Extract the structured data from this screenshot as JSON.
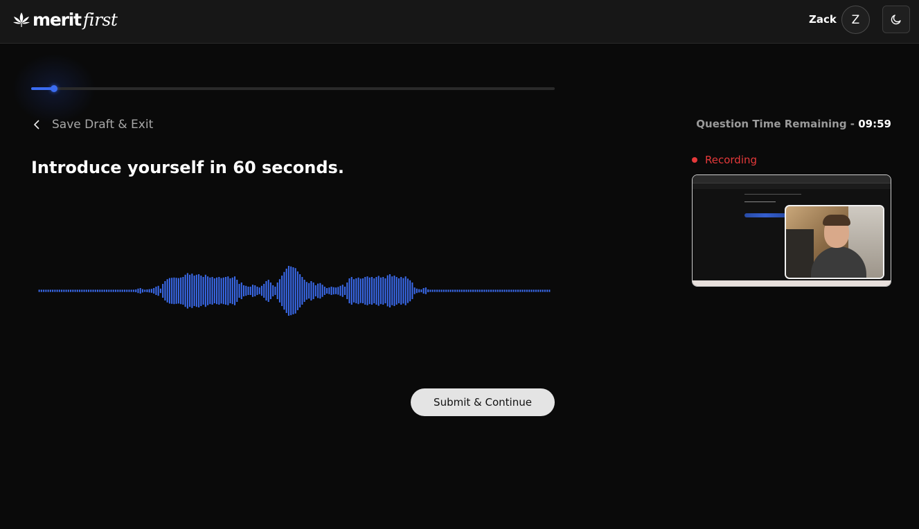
{
  "header": {
    "brand": {
      "bold": "merit",
      "italic": "first"
    },
    "user_name": "Zack",
    "avatar_initial": "Z",
    "theme_icon": "moon-icon"
  },
  "progress": {
    "fraction": 0.044
  },
  "nav": {
    "back_label": "Save Draft & Exit",
    "back_icon": "chevron-left-icon"
  },
  "timer": {
    "label": "Question Time Remaining - ",
    "value": "09:59"
  },
  "question": {
    "text": "Introduce yourself in 60 seconds."
  },
  "recording": {
    "label": "Recording",
    "color": "#e5393a"
  },
  "actions": {
    "submit_label": "Submit & Continue"
  },
  "colors": {
    "accent": "#3b6cf0",
    "background": "#0a0a0a",
    "topbar": "#171717"
  },
  "waveform": {
    "levels": [
      0.04,
      0.04,
      0.04,
      0.04,
      0.04,
      0.04,
      0.04,
      0.04,
      0.04,
      0.04,
      0.04,
      0.04,
      0.04,
      0.04,
      0.04,
      0.04,
      0.04,
      0.04,
      0.04,
      0.04,
      0.04,
      0.04,
      0.04,
      0.04,
      0.04,
      0.04,
      0.04,
      0.04,
      0.04,
      0.04,
      0.04,
      0.04,
      0.04,
      0.04,
      0.04,
      0.04,
      0.04,
      0.04,
      0.04,
      0.04,
      0.04,
      0.04,
      0.04,
      0.05,
      0.08,
      0.1,
      0.06,
      0.04,
      0.05,
      0.06,
      0.07,
      0.1,
      0.15,
      0.18,
      0.08,
      0.25,
      0.35,
      0.42,
      0.46,
      0.47,
      0.48,
      0.47,
      0.46,
      0.48,
      0.5,
      0.58,
      0.64,
      0.58,
      0.62,
      0.55,
      0.58,
      0.6,
      0.55,
      0.5,
      0.58,
      0.52,
      0.48,
      0.5,
      0.45,
      0.48,
      0.5,
      0.46,
      0.48,
      0.5,
      0.52,
      0.45,
      0.48,
      0.52,
      0.4,
      0.25,
      0.3,
      0.2,
      0.18,
      0.15,
      0.15,
      0.22,
      0.2,
      0.15,
      0.12,
      0.18,
      0.25,
      0.35,
      0.4,
      0.3,
      0.2,
      0.15,
      0.3,
      0.42,
      0.55,
      0.68,
      0.8,
      0.9,
      0.88,
      0.85,
      0.82,
      0.7,
      0.6,
      0.5,
      0.4,
      0.32,
      0.28,
      0.35,
      0.3,
      0.2,
      0.26,
      0.28,
      0.22,
      0.15,
      0.1,
      0.12,
      0.15,
      0.13,
      0.12,
      0.14,
      0.18,
      0.22,
      0.15,
      0.3,
      0.45,
      0.5,
      0.42,
      0.45,
      0.48,
      0.44,
      0.45,
      0.5,
      0.52,
      0.48,
      0.5,
      0.45,
      0.5,
      0.54,
      0.48,
      0.5,
      0.45,
      0.56,
      0.6,
      0.52,
      0.55,
      0.5,
      0.45,
      0.5,
      0.46,
      0.52,
      0.44,
      0.38,
      0.3,
      0.12,
      0.08,
      0.06,
      0.05,
      0.1,
      0.12,
      0.05,
      0.04,
      0.04,
      0.04,
      0.04,
      0.04,
      0.04,
      0.04,
      0.04,
      0.04,
      0.04,
      0.04,
      0.04,
      0.04,
      0.04,
      0.04,
      0.04,
      0.04,
      0.04,
      0.04,
      0.04,
      0.04,
      0.04,
      0.04,
      0.04,
      0.04,
      0.04,
      0.04,
      0.04,
      0.04,
      0.04,
      0.04,
      0.04,
      0.04,
      0.04,
      0.04,
      0.04,
      0.04,
      0.04,
      0.04,
      0.04,
      0.04,
      0.04,
      0.04,
      0.04,
      0.04,
      0.04,
      0.04,
      0.04,
      0.04,
      0.04,
      0.04,
      0.04,
      0.04,
      0.04
    ]
  }
}
